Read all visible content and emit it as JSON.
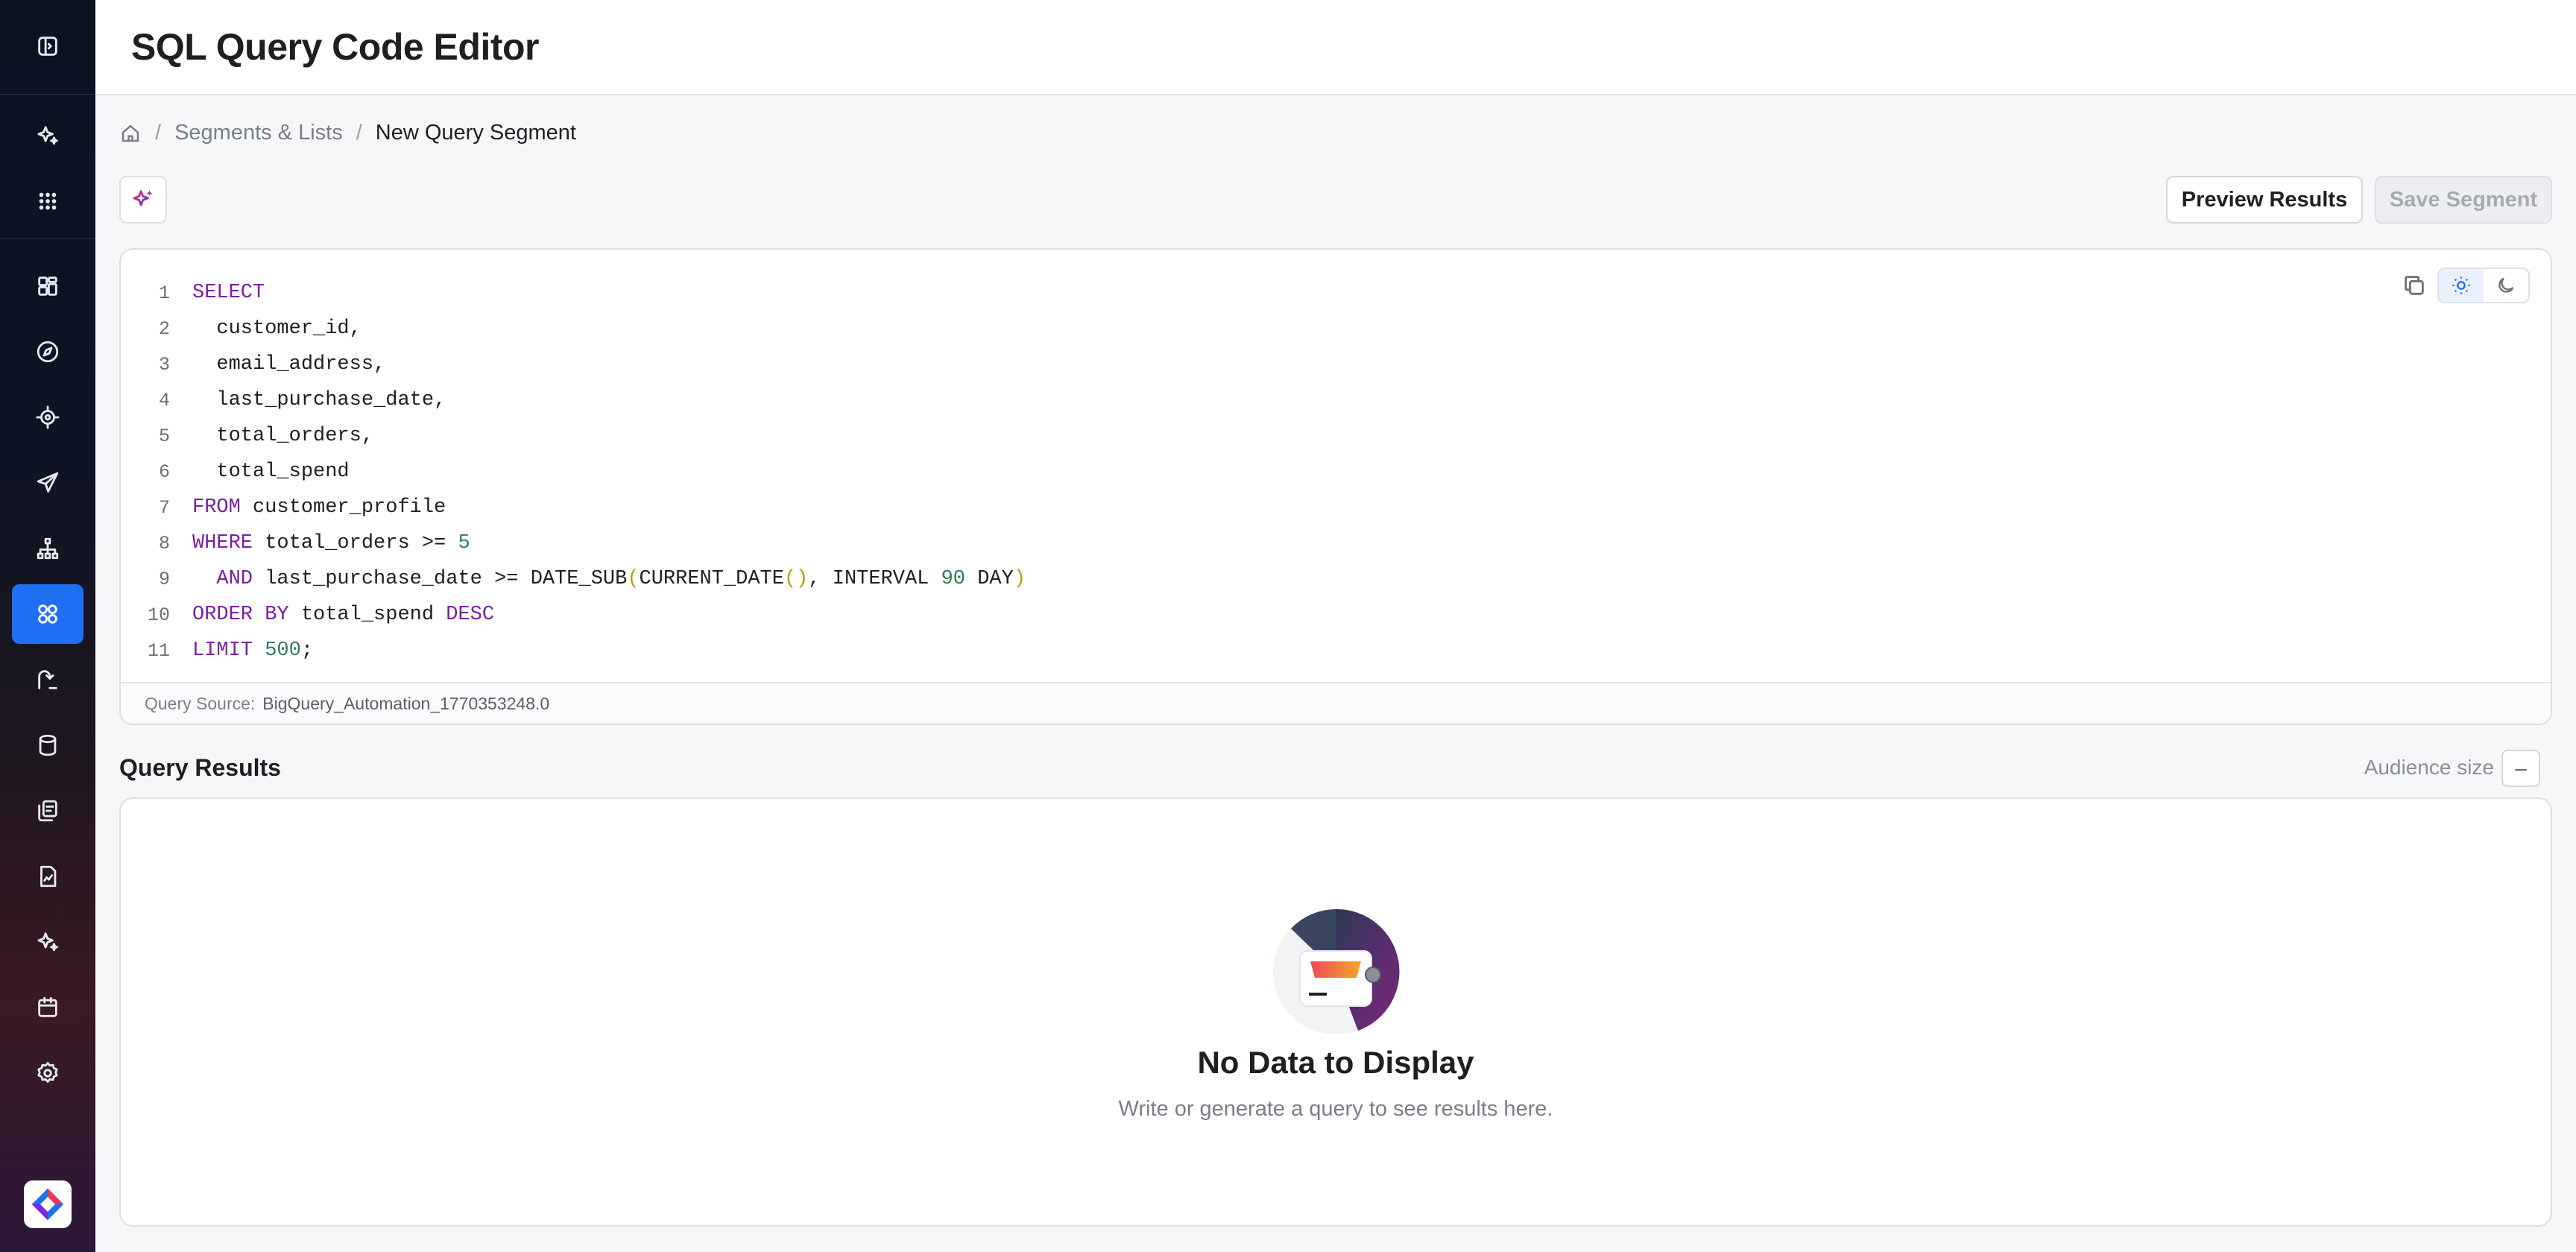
{
  "header": {
    "title": "SQL Query Code Editor"
  },
  "sidebar": {
    "items": [
      {
        "icon": "panel-toggle-icon"
      },
      {
        "icon": "sparkle-icon"
      },
      {
        "icon": "apps-grid-icon"
      },
      {
        "icon": "dashboard-icon"
      },
      {
        "icon": "compass-icon"
      },
      {
        "icon": "target-icon"
      },
      {
        "icon": "send-icon"
      },
      {
        "icon": "hierarchy-icon"
      },
      {
        "icon": "segments-icon",
        "active": true
      },
      {
        "icon": "journey-icon"
      },
      {
        "icon": "database-icon"
      },
      {
        "icon": "library-icon"
      },
      {
        "icon": "report-icon"
      },
      {
        "icon": "ai-icon"
      },
      {
        "icon": "calendar-icon"
      },
      {
        "icon": "settings-icon"
      }
    ],
    "accent_color": "#1f6ff2"
  },
  "breadcrumb": {
    "items": [
      "Segments & Lists",
      "New Query Segment"
    ],
    "separator": "/"
  },
  "toolbar": {
    "preview_label": "Preview Results",
    "save_label": "Save Segment"
  },
  "editor": {
    "line_numbers": [
      "1",
      "2",
      "3",
      "4",
      "5",
      "6",
      "7",
      "8",
      "9",
      "10",
      "11"
    ],
    "lines": [
      "SELECT",
      "  customer_id,",
      "  email_address,",
      "  last_purchase_date,",
      "  total_orders,",
      "  total_spend",
      "FROM customer_profile",
      "WHERE total_orders >= 5",
      "  AND last_purchase_date >= DATE_SUB(CURRENT_DATE(), INTERVAL 90 DAY)",
      "ORDER BY total_spend DESC",
      "LIMIT 500;"
    ],
    "query_source_label": "Query Source:",
    "query_source_value": "BigQuery_Automation_1770353248.0"
  },
  "results": {
    "title": "Query Results",
    "audience_label": "Audience size",
    "audience_value": "–",
    "empty_title": "No Data to Display",
    "empty_subtitle": "Write or generate a query to see results here."
  }
}
